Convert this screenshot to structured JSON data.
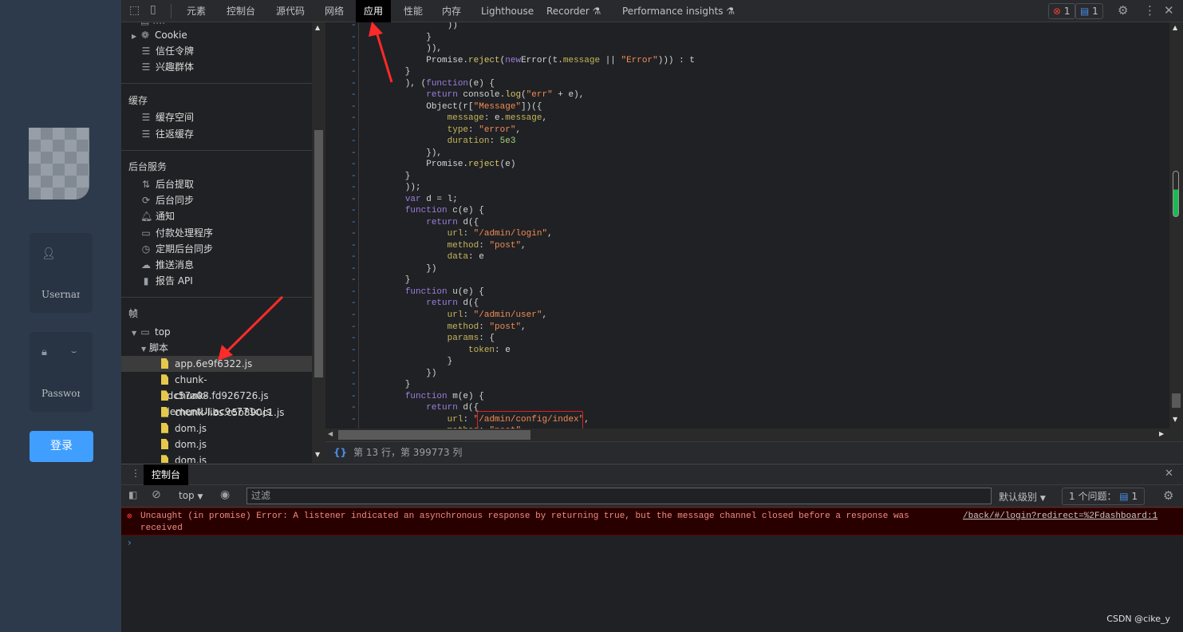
{
  "page": {
    "username_placeholder": "Username",
    "password_placeholder": "Password",
    "login_button": "登录"
  },
  "toolbar": {
    "tabs": [
      "元素",
      "控制台",
      "源代码",
      "网络",
      "应用",
      "性能",
      "内存",
      "Lighthouse",
      "Recorder ⚗",
      "Performance insights ⚗"
    ],
    "active_tab": "应用",
    "error_count": "1",
    "message_count": "1"
  },
  "sidebar": {
    "storage_items": [
      {
        "icon": "cookie-icon",
        "label": "Cookie"
      },
      {
        "icon": "database-icon",
        "label": "信任令牌"
      },
      {
        "icon": "database-icon",
        "label": "兴趣群体"
      }
    ],
    "cache_header": "缓存",
    "cache_items": [
      {
        "icon": "database-icon",
        "label": "缓存空间"
      },
      {
        "icon": "database-icon",
        "label": "往返缓存"
      }
    ],
    "bg_header": "后台服务",
    "bg_items": [
      {
        "icon": "arrows-icon",
        "label": "后台提取"
      },
      {
        "icon": "sync-icon",
        "label": "后台同步"
      },
      {
        "icon": "bell-icon",
        "label": "通知"
      },
      {
        "icon": "card-icon",
        "label": "付款处理程序"
      },
      {
        "icon": "clock-icon",
        "label": "定期后台同步"
      },
      {
        "icon": "cloud-icon",
        "label": "推送消息"
      },
      {
        "icon": "file-icon",
        "label": "报告 API"
      }
    ],
    "frames_header": "帧",
    "frame_top": "top",
    "scripts_folder": "脚本",
    "files": [
      "app.6e9f6322.js",
      "chunk-2dc57a08.fd926726.js",
      "chunk-elementUI.ac9e771c.js",
      "chunk-libs.c5b890c1.js",
      "dom.js",
      "dom.js",
      "dom.js"
    ],
    "selected_file": "app.6e9f6322.js"
  },
  "editor": {
    "lines": [
      [
        [
          "",
          "                ))"
        ]
      ],
      [
        [
          "",
          "            }"
        ]
      ],
      [
        [
          "",
          "            )),"
        ]
      ],
      [
        [
          "",
          "            Promise."
        ],
        [
          "f",
          "reject"
        ],
        [
          "",
          "("
        ],
        [
          "k",
          "new"
        ],
        [
          "",
          "Error(t."
        ],
        [
          "p",
          "message"
        ],
        [
          "",
          " || "
        ],
        [
          "s",
          "\"Error\""
        ],
        [
          "",
          "))) : t"
        ]
      ],
      [
        [
          "",
          "        }"
        ]
      ],
      [
        [
          "",
          "        ), ("
        ],
        [
          "k",
          "function"
        ],
        [
          "",
          "(e) {"
        ]
      ],
      [
        [
          "",
          "            "
        ],
        [
          "k",
          "return"
        ],
        [
          "",
          " console."
        ],
        [
          "f",
          "log"
        ],
        [
          "",
          "("
        ],
        [
          "s",
          "\"err\""
        ],
        [
          "",
          " + e),"
        ]
      ],
      [
        [
          "",
          "            Object(r["
        ],
        [
          "s",
          "\"Message\""
        ],
        [
          "",
          "])({"
        ]
      ],
      [
        [
          "",
          "                "
        ],
        [
          "p",
          "message"
        ],
        [
          "",
          ": e."
        ],
        [
          "p",
          "message"
        ],
        [
          "",
          ","
        ]
      ],
      [
        [
          "",
          "                "
        ],
        [
          "p",
          "type"
        ],
        [
          "",
          ": "
        ],
        [
          "s",
          "\"error\""
        ],
        [
          "",
          ","
        ]
      ],
      [
        [
          "",
          "                "
        ],
        [
          "p",
          "duration"
        ],
        [
          "",
          ": "
        ],
        [
          "n",
          "5e3"
        ]
      ],
      [
        [
          "",
          "            }),"
        ]
      ],
      [
        [
          "",
          "            Promise."
        ],
        [
          "f",
          "reject"
        ],
        [
          "",
          "(e)"
        ]
      ],
      [
        [
          "",
          "        }"
        ]
      ],
      [
        [
          "",
          "        ));"
        ]
      ],
      [
        [
          "",
          "        "
        ],
        [
          "k",
          "var"
        ],
        [
          "",
          " d = l;"
        ]
      ],
      [
        [
          "",
          "        "
        ],
        [
          "k",
          "function"
        ],
        [
          "",
          " c(e) {"
        ]
      ],
      [
        [
          "",
          "            "
        ],
        [
          "k",
          "return"
        ],
        [
          "",
          " d({"
        ]
      ],
      [
        [
          "",
          "                "
        ],
        [
          "p",
          "url"
        ],
        [
          "",
          ": "
        ],
        [
          "s",
          "\"/admin/login\""
        ],
        [
          "",
          ","
        ]
      ],
      [
        [
          "",
          "                "
        ],
        [
          "p",
          "method"
        ],
        [
          "",
          ": "
        ],
        [
          "s",
          "\"post\""
        ],
        [
          "",
          ","
        ]
      ],
      [
        [
          "",
          "                "
        ],
        [
          "p",
          "data"
        ],
        [
          "",
          ": e"
        ]
      ],
      [
        [
          "",
          "            })"
        ]
      ],
      [
        [
          "",
          "        }"
        ]
      ],
      [
        [
          "",
          "        "
        ],
        [
          "k",
          "function"
        ],
        [
          "",
          " u(e) {"
        ]
      ],
      [
        [
          "",
          "            "
        ],
        [
          "k",
          "return"
        ],
        [
          "",
          " d({"
        ]
      ],
      [
        [
          "",
          "                "
        ],
        [
          "p",
          "url"
        ],
        [
          "",
          ": "
        ],
        [
          "s",
          "\"/admin/user\""
        ],
        [
          "",
          ","
        ]
      ],
      [
        [
          "",
          "                "
        ],
        [
          "p",
          "method"
        ],
        [
          "",
          ": "
        ],
        [
          "s",
          "\"post\""
        ],
        [
          "",
          ","
        ]
      ],
      [
        [
          "",
          "                "
        ],
        [
          "p",
          "params"
        ],
        [
          "",
          ": {"
        ]
      ],
      [
        [
          "",
          "                    "
        ],
        [
          "p",
          "token"
        ],
        [
          "",
          ": e"
        ]
      ],
      [
        [
          "",
          "                }"
        ]
      ],
      [
        [
          "",
          "            })"
        ]
      ],
      [
        [
          "",
          "        }"
        ]
      ],
      [
        [
          "",
          "        "
        ],
        [
          "k",
          "function"
        ],
        [
          "",
          " m(e) {"
        ]
      ],
      [
        [
          "",
          "            "
        ],
        [
          "k",
          "return"
        ],
        [
          "",
          " d({"
        ]
      ],
      [
        [
          "",
          "                "
        ],
        [
          "p",
          "url"
        ],
        [
          "",
          ": "
        ],
        [
          "s",
          "\"/admin/config/index\""
        ],
        [
          "",
          ","
        ]
      ],
      [
        [
          "",
          "                "
        ],
        [
          "p",
          "method"
        ],
        [
          "",
          ": "
        ],
        [
          "s",
          "\"post\""
        ]
      ]
    ],
    "status": "第 13 行，第 399773 列"
  },
  "drawer": {
    "tab": "控制台",
    "context": "top",
    "filter_placeholder": "过滤",
    "level": "默认级别",
    "issues_label": "1 个问题：",
    "issues_count": "1"
  },
  "console": {
    "error": "Uncaught (in promise) Error: A listener indicated an asynchronous response by returning true, but the message channel closed before a response was",
    "error_cont": "received",
    "source": "/back/#/login?redirect=%2Fdashboard:1"
  },
  "watermark": "CSDN @cike_y",
  "colors": {
    "accent": "#409eff",
    "error": "#f28b82",
    "annotation": "#ff2a2a"
  }
}
